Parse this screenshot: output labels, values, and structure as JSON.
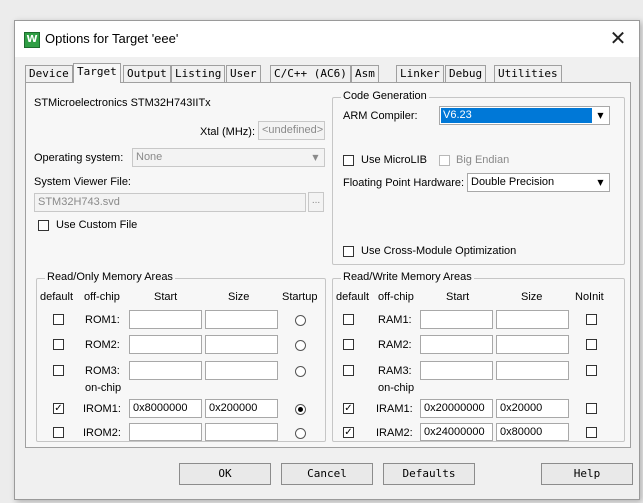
{
  "window": {
    "title": "Options for Target 'eee'",
    "icon": "W"
  },
  "tabs": [
    "Device",
    "Target",
    "Output",
    "Listing",
    "User",
    "C/C++ (AC6)",
    "Asm",
    "Linker",
    "Debug",
    "Utilities"
  ],
  "target": {
    "device_name": "STMicroelectronics STM32H743IITx",
    "xtal_label": "Xtal (MHz):",
    "xtal_value": "<undefined>",
    "os_label": "Operating system:",
    "os_value": "None",
    "svd_label": "System Viewer File:",
    "svd_value": "STM32H743.svd",
    "browse_label": "...",
    "custom_file_label": "Use Custom File"
  },
  "code_generation": {
    "title": "Code Generation",
    "compiler_label": "ARM Compiler:",
    "compiler_value": "V6.23",
    "microlib_label": "Use MicroLIB",
    "big_endian_label": "Big Endian",
    "fph_label": "Floating Point Hardware:",
    "fph_value": "Double Precision",
    "cross_module_label": "Use Cross-Module Optimization"
  },
  "ro_memory": {
    "title": "Read/Only Memory Areas",
    "headers": {
      "default": "default",
      "offchip": "off-chip",
      "start": "Start",
      "size": "Size",
      "last": "Startup"
    },
    "onchip_label": "on-chip",
    "rows": [
      {
        "name": "ROM1:",
        "start": "",
        "size": "",
        "checked": false,
        "radio": false
      },
      {
        "name": "ROM2:",
        "start": "",
        "size": "",
        "checked": false,
        "radio": false
      },
      {
        "name": "ROM3:",
        "start": "",
        "size": "",
        "checked": false,
        "radio": false
      },
      {
        "name": "IROM1:",
        "start": "0x8000000",
        "size": "0x200000",
        "checked": true,
        "radio": true
      },
      {
        "name": "IROM2:",
        "start": "",
        "size": "",
        "checked": false,
        "radio": false
      }
    ]
  },
  "rw_memory": {
    "title": "Read/Write Memory Areas",
    "headers": {
      "default": "default",
      "offchip": "off-chip",
      "start": "Start",
      "size": "Size",
      "last": "NoInit"
    },
    "onchip_label": "on-chip",
    "rows": [
      {
        "name": "RAM1:",
        "start": "",
        "size": "",
        "checked": false,
        "noinit": false
      },
      {
        "name": "RAM2:",
        "start": "",
        "size": "",
        "checked": false,
        "noinit": false
      },
      {
        "name": "RAM3:",
        "start": "",
        "size": "",
        "checked": false,
        "noinit": false
      },
      {
        "name": "IRAM1:",
        "start": "0x20000000",
        "size": "0x20000",
        "checked": true,
        "noinit": false
      },
      {
        "name": "IRAM2:",
        "start": "0x24000000",
        "size": "0x80000",
        "checked": true,
        "noinit": false
      }
    ]
  },
  "buttons": {
    "ok": "OK",
    "cancel": "Cancel",
    "defaults": "Defaults",
    "help": "Help"
  },
  "colors": {
    "selection": "#0078d7",
    "window_bg": "#f0f0f0"
  }
}
